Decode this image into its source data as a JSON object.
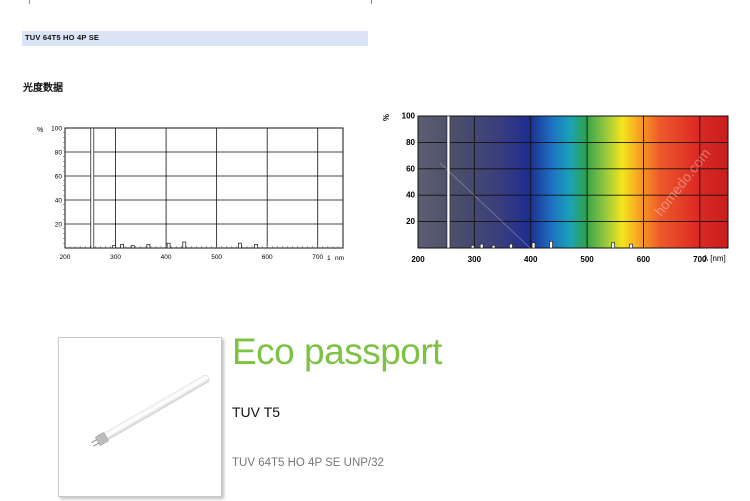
{
  "header": {
    "model_code": "TUV 64T5 HO 4P SE"
  },
  "section": {
    "title": "光度数据"
  },
  "left_chart": {
    "y_unit": "%",
    "x_unit": "nm",
    "x_ticks": [
      "200",
      "300",
      "400",
      "500",
      "600",
      "700"
    ],
    "x_end_label": "1",
    "y_ticks": [
      "100",
      "80",
      "60",
      "40",
      "20"
    ]
  },
  "right_chart": {
    "y_unit": "%",
    "x_unit": "λ [nm]",
    "x_ticks": [
      "200",
      "300",
      "400",
      "500",
      "600",
      "700"
    ],
    "y_ticks": [
      "100",
      "80",
      "60",
      "40",
      "20"
    ],
    "watermark": "homedo.com"
  },
  "chart_data": [
    {
      "type": "bar",
      "title": "",
      "xlabel": "nm",
      "ylabel": "%",
      "xlim": [
        200,
        750
      ],
      "ylim": [
        0,
        100
      ],
      "x": [
        254,
        297,
        313,
        334,
        365,
        405,
        436,
        546,
        578
      ],
      "values": [
        100,
        2,
        3,
        2,
        3,
        4,
        5,
        4,
        3
      ],
      "grid": true
    },
    {
      "type": "bar",
      "title": "",
      "xlabel": "λ [nm]",
      "ylabel": "%",
      "xlim": [
        200,
        750
      ],
      "ylim": [
        0,
        100
      ],
      "x": [
        254,
        297,
        313,
        334,
        365,
        405,
        436,
        546,
        578
      ],
      "values": [
        100,
        2,
        3,
        2,
        3,
        4,
        5,
        4,
        3
      ],
      "grid": true,
      "background": "visible spectrum gradient"
    }
  ],
  "eco": {
    "title": "Eco passport",
    "product_name": "TUV T5",
    "product_code": "TUV 64T5 HO 4P SE UNP/32",
    "title_color": "#7dc242"
  }
}
